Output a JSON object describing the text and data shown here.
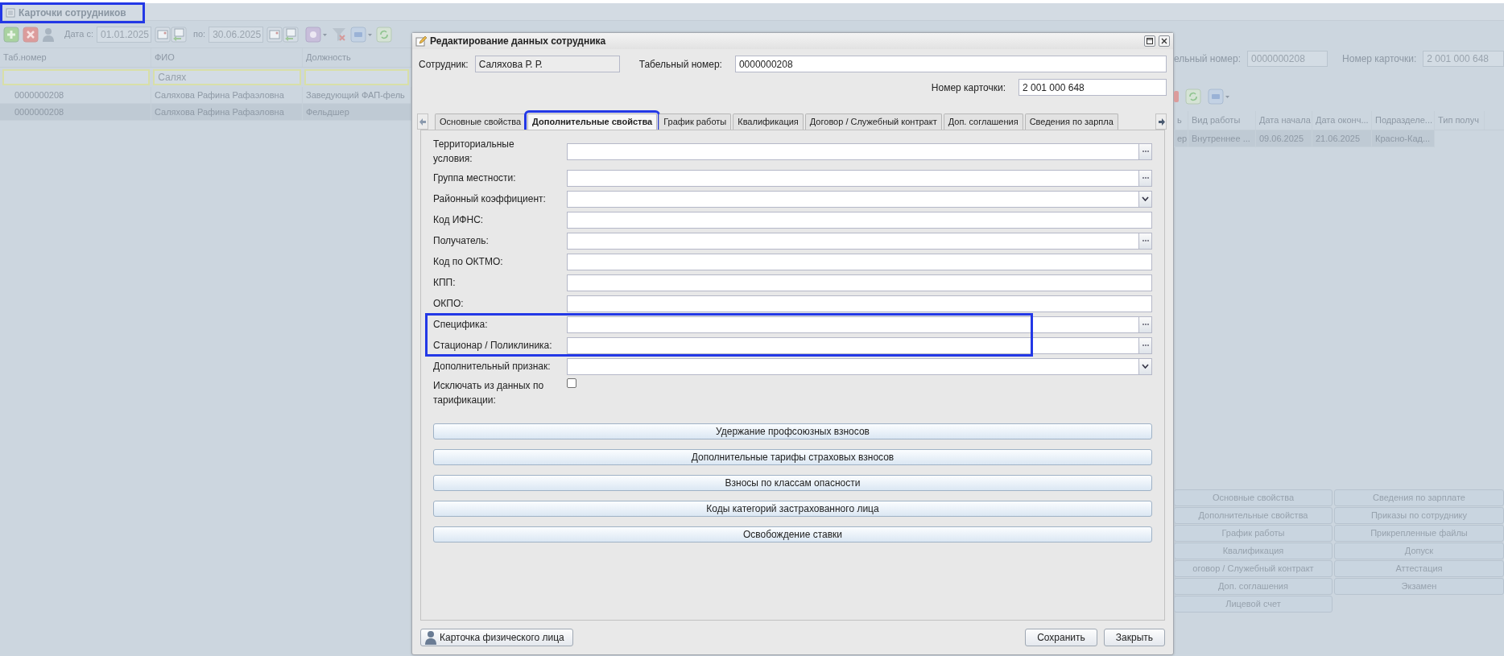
{
  "page_title": {
    "text": "Карточки сотрудников",
    "highlighted": true
  },
  "left_toolbar": {
    "date_from_label": "Дата с:",
    "date_from": "01.01.2025",
    "date_to_label": "по:",
    "date_to": "30.06.2025"
  },
  "employees_table": {
    "columns": [
      "Таб.номер",
      "ФИО",
      "Должность"
    ],
    "name_filter": "Салях",
    "rows": [
      {
        "cells": [
          "0000000208",
          "Саляхова Рафина Рафаэловна",
          "Заведующий ФАП-фель"
        ],
        "selected": false
      },
      {
        "cells": [
          "0000000208",
          "Саляхова Рафина Рафаэловна",
          "Фельдшер"
        ],
        "selected": true
      }
    ]
  },
  "details_panel": {
    "fields": [
      {
        "label": "ельный номер:",
        "value": "0000000208"
      },
      {
        "label": "Номер карточки:",
        "value": "2 001 000 648"
      }
    ],
    "table": {
      "columns": [
        "ь",
        "Вид работы",
        "Дата начала",
        "Дата оконч...",
        "Подразделе...",
        "Тип получ"
      ],
      "rows": [
        {
          "cells": [
            "ер",
            "Внутреннее ...",
            "09.06.2025",
            "21.06.2025",
            "Красно-Кад..."
          ],
          "selected": true
        }
      ]
    },
    "section_buttons_left": [
      "Основные свойства",
      "Дополнительные свойства",
      "График работы",
      "Квалификация",
      "оговор / Служебный контракт",
      "Доп. соглашения",
      "Лицевой счет"
    ],
    "section_buttons_right": [
      "Сведения по зарплате",
      "Приказы по сотруднику",
      "Прикрепленные файлы",
      "Допуск",
      "Аттестация",
      "Экзамен"
    ]
  },
  "dialog": {
    "title": "Редактирование данных сотрудника",
    "employee_label": "Сотрудник:",
    "employee": "Саляхова Р. Р.",
    "tab_number_label": "Табельный номер:",
    "tab_number": "0000000208",
    "card_number_label": "Номер карточки:",
    "card_number": "2 001 000 648",
    "tabs": [
      {
        "label": "Основные свойства",
        "selected": false,
        "highlighted": false
      },
      {
        "label": "Дополнительные свойства",
        "selected": true,
        "highlighted": true
      },
      {
        "label": "График работы",
        "selected": false,
        "highlighted": false
      },
      {
        "label": "Квалификация",
        "selected": false,
        "highlighted": false
      },
      {
        "label": "Договор / Служебный контракт",
        "selected": false,
        "highlighted": false
      },
      {
        "label": "Доп. соглашения",
        "selected": false,
        "highlighted": false
      },
      {
        "label": "Сведения по зарпла",
        "selected": false,
        "highlighted": false
      }
    ],
    "form": [
      {
        "label": "Территориальные условия:",
        "kind": "picker",
        "highlighted": false
      },
      {
        "label": "Группа местности:",
        "kind": "picker",
        "highlighted": false
      },
      {
        "label": "Районный коэффициент:",
        "kind": "combo",
        "highlighted": false
      },
      {
        "label": "Код ИФНС:",
        "kind": "text",
        "highlighted": false
      },
      {
        "label": "Получатель:",
        "kind": "picker",
        "highlighted": false
      },
      {
        "label": "Код по ОКТМО:",
        "kind": "text",
        "highlighted": false
      },
      {
        "label": "КПП:",
        "kind": "text",
        "highlighted": false
      },
      {
        "label": "ОКПО:",
        "kind": "text",
        "highlighted": false
      },
      {
        "label": "Специфика:",
        "kind": "picker",
        "highlighted": true
      },
      {
        "label": "Стационар / Поликлиника:",
        "kind": "picker",
        "highlighted": true
      },
      {
        "label": "Дополнительный признак:",
        "kind": "combo",
        "highlighted": false
      },
      {
        "label": "Исключать из данных по тарификации:",
        "kind": "checkbox",
        "checked": false,
        "highlighted": false
      }
    ],
    "action_buttons": [
      "Удержание профсоюзных взносов",
      "Дополнительные тарифы страховых взносов",
      "Взносы по классам опасности",
      "Коды категорий застрахованного лица",
      "Освобождение ставки"
    ],
    "person_card_button": "Карточка физического лица",
    "footer_buttons": [
      "Сохранить",
      "Закрыть"
    ]
  }
}
